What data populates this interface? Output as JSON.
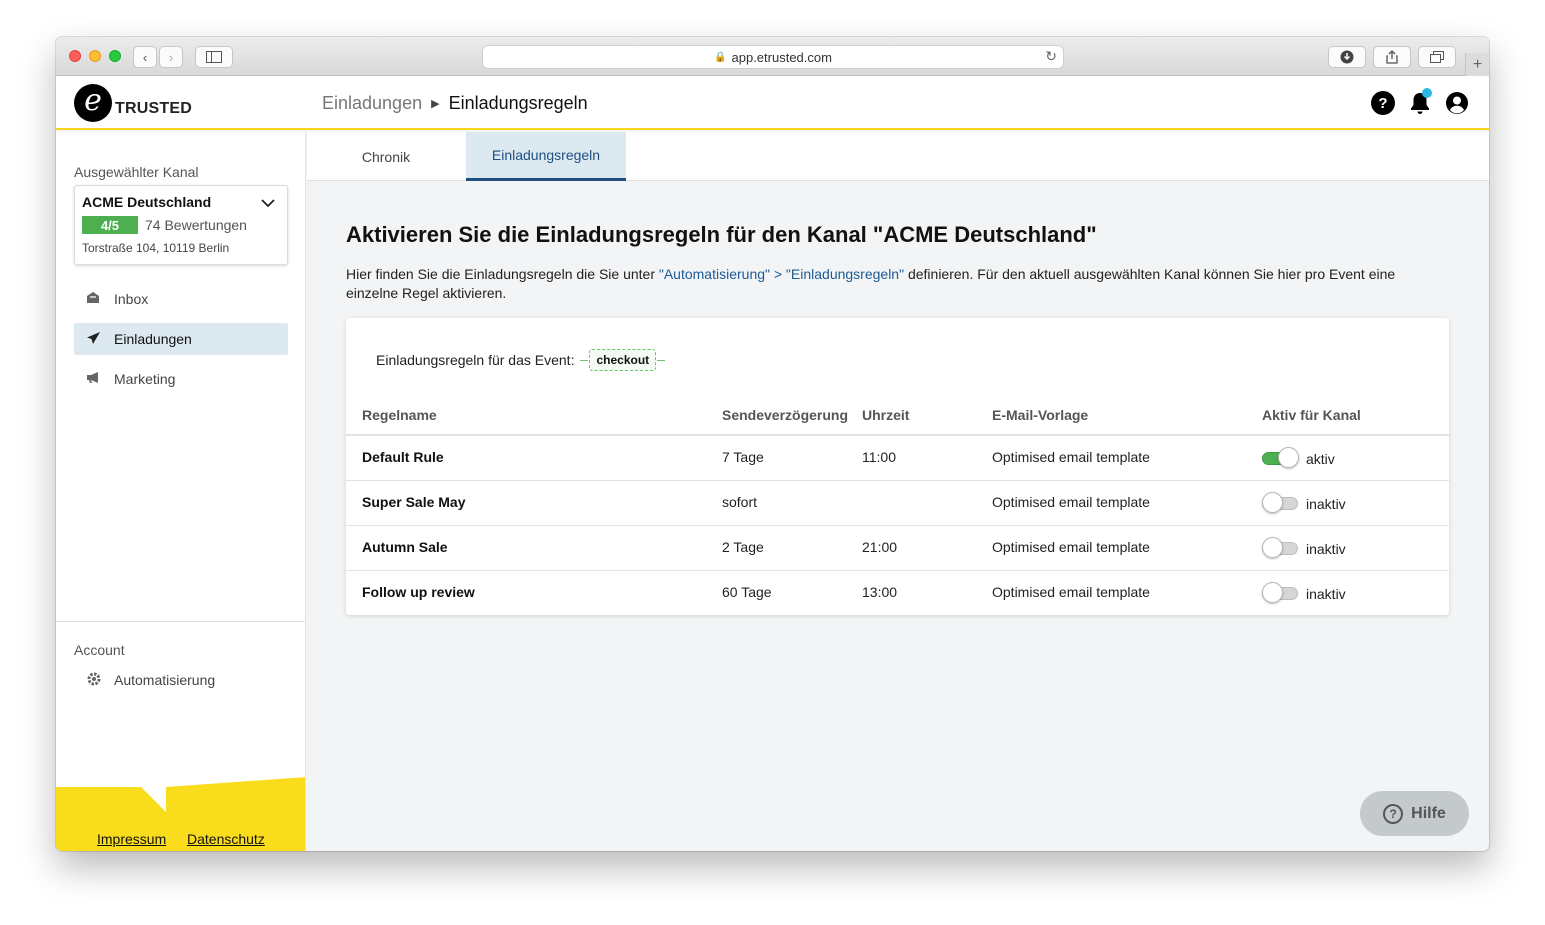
{
  "browser": {
    "url": "app.etrusted.com"
  },
  "header": {
    "logo_letter": "e",
    "logo_text": "TRUSTED",
    "breadcrumb_parent": "Einladungen",
    "breadcrumb_current": "Einladungsregeln",
    "help_glyph": "?"
  },
  "sidebar": {
    "channel_label": "Ausgewählter Kanal",
    "channel": {
      "name": "ACME Deutschland",
      "score": "4/5",
      "reviews": "74 Bewertungen",
      "address": "Torstraße 104, 10119 Berlin"
    },
    "nav": [
      {
        "label": "Inbox",
        "icon": "inbox-icon"
      },
      {
        "label": "Einladungen",
        "icon": "send-icon"
      },
      {
        "label": "Marketing",
        "icon": "megaphone-icon"
      }
    ],
    "account_label": "Account",
    "account_items": [
      {
        "label": "Automatisierung",
        "icon": "automation-gear-icon"
      }
    ],
    "footer": {
      "impressum": "Impressum",
      "datenschutz": "Datenschutz"
    }
  },
  "tabs": [
    {
      "label": "Chronik",
      "active": false
    },
    {
      "label": "Einladungsregeln",
      "active": true
    }
  ],
  "main": {
    "title": "Aktivieren Sie die Einladungsregeln für den Kanal \"ACME Deutschland\"",
    "intro_before": "Hier finden Sie die Einladungsregeln die Sie unter ",
    "intro_link": "\"Automatisierung\" > \"Einladungsregeln\"",
    "intro_after": " definieren. Für den aktuell ausgewählten Kanal können Sie hier pro Event eine einzelne Regel aktivieren.",
    "event_label": "Einladungsregeln für das Event:",
    "event_tag": "checkout"
  },
  "table": {
    "headers": [
      "Regelname",
      "Sendeverzögerung",
      "Uhrzeit",
      "E-Mail-Vorlage",
      "Aktiv für Kanal"
    ],
    "rows": [
      {
        "name": "Default Rule",
        "delay": "7 Tage",
        "time": "11:00",
        "template": "Optimised email template",
        "active": true,
        "status": "aktiv"
      },
      {
        "name": "Super Sale May",
        "delay": "sofort",
        "time": "",
        "template": "Optimised email template",
        "active": false,
        "status": "inaktiv"
      },
      {
        "name": "Autumn Sale",
        "delay": "2 Tage",
        "time": "21:00",
        "template": "Optimised email template",
        "active": false,
        "status": "inaktiv"
      },
      {
        "name": "Follow up review",
        "delay": "60 Tage",
        "time": "13:00",
        "template": "Optimised email template",
        "active": false,
        "status": "inaktiv"
      }
    ]
  },
  "help_button": {
    "glyph": "?",
    "label": "Hilfe"
  },
  "colors": {
    "accent_yellow": "#f6d51f",
    "active_tab_blue": "#1e4f80",
    "toggle_on_green": "#4caf50",
    "score_green": "#4caf50",
    "link_blue": "#1e5a96"
  }
}
